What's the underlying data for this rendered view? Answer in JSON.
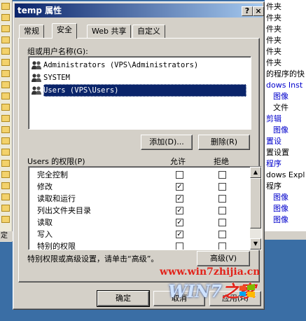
{
  "background": {
    "right_rows": [
      {
        "text": "件夹",
        "blue": false,
        "ind": false
      },
      {
        "text": "件夹",
        "blue": false,
        "ind": false
      },
      {
        "text": "件夹",
        "blue": false,
        "ind": false
      },
      {
        "text": "件夹",
        "blue": false,
        "ind": false
      },
      {
        "text": "件夹",
        "blue": false,
        "ind": false
      },
      {
        "text": "件夹",
        "blue": false,
        "ind": false
      },
      {
        "text": "的程序的快",
        "blue": false,
        "ind": false
      },
      {
        "text": "dows Inst",
        "blue": true,
        "ind": false
      },
      {
        "text": "图像",
        "blue": true,
        "ind": true
      },
      {
        "text": "文件",
        "blue": false,
        "ind": true
      },
      {
        "text": "剪辑",
        "blue": true,
        "ind": false
      },
      {
        "text": "图像",
        "blue": true,
        "ind": true
      },
      {
        "text": "置设",
        "blue": true,
        "ind": false
      },
      {
        "text": "置设置",
        "blue": false,
        "ind": false
      },
      {
        "text": "程序",
        "blue": true,
        "ind": false
      },
      {
        "text": "dows Expl",
        "blue": false,
        "ind": false
      },
      {
        "text": "程序",
        "blue": false,
        "ind": false
      },
      {
        "text": "图像",
        "blue": true,
        "ind": true
      },
      {
        "text": "图像",
        "blue": true,
        "ind": true
      },
      {
        "text": "图像",
        "blue": true,
        "ind": true
      }
    ],
    "bottom_left_text": "定"
  },
  "dialog": {
    "title": "temp 属性",
    "help_btn": "?",
    "close_btn": "×",
    "tabs": [
      "常规",
      "安全",
      "Web 共享",
      "自定义"
    ],
    "active_tab": 1,
    "group_label": "组或用户名称(G):",
    "users": [
      {
        "name": "Administrators (VPS\\Administrators)",
        "selected": false
      },
      {
        "name": "SYSTEM",
        "selected": false
      },
      {
        "name": "Users (VPS\\Users)",
        "selected": true
      }
    ],
    "add_button": "添加(D)...",
    "remove_button": "删除(R)",
    "perm_label": "Users 的权限(P)",
    "allow_header": "允许",
    "deny_header": "拒绝",
    "permissions": [
      {
        "name": "完全控制",
        "allow": false,
        "deny": false
      },
      {
        "name": "修改",
        "allow": true,
        "deny": false
      },
      {
        "name": "读取和运行",
        "allow": true,
        "deny": false
      },
      {
        "name": "列出文件夹目录",
        "allow": true,
        "deny": false
      },
      {
        "name": "读取",
        "allow": true,
        "deny": false
      },
      {
        "name": "写入",
        "allow": true,
        "deny": false
      },
      {
        "name": "特别的权限",
        "allow": false,
        "deny": false
      }
    ],
    "special_note": "特别权限或高级设置，请单击“高级”。",
    "advanced_button": "高级(V)",
    "ok_button": "确定",
    "cancel_button": "取消",
    "apply_button": "应用(A)"
  },
  "watermark": {
    "url": "www.win7zhijia.cn",
    "logo": "WIN7",
    "logo_zh": "之家"
  }
}
